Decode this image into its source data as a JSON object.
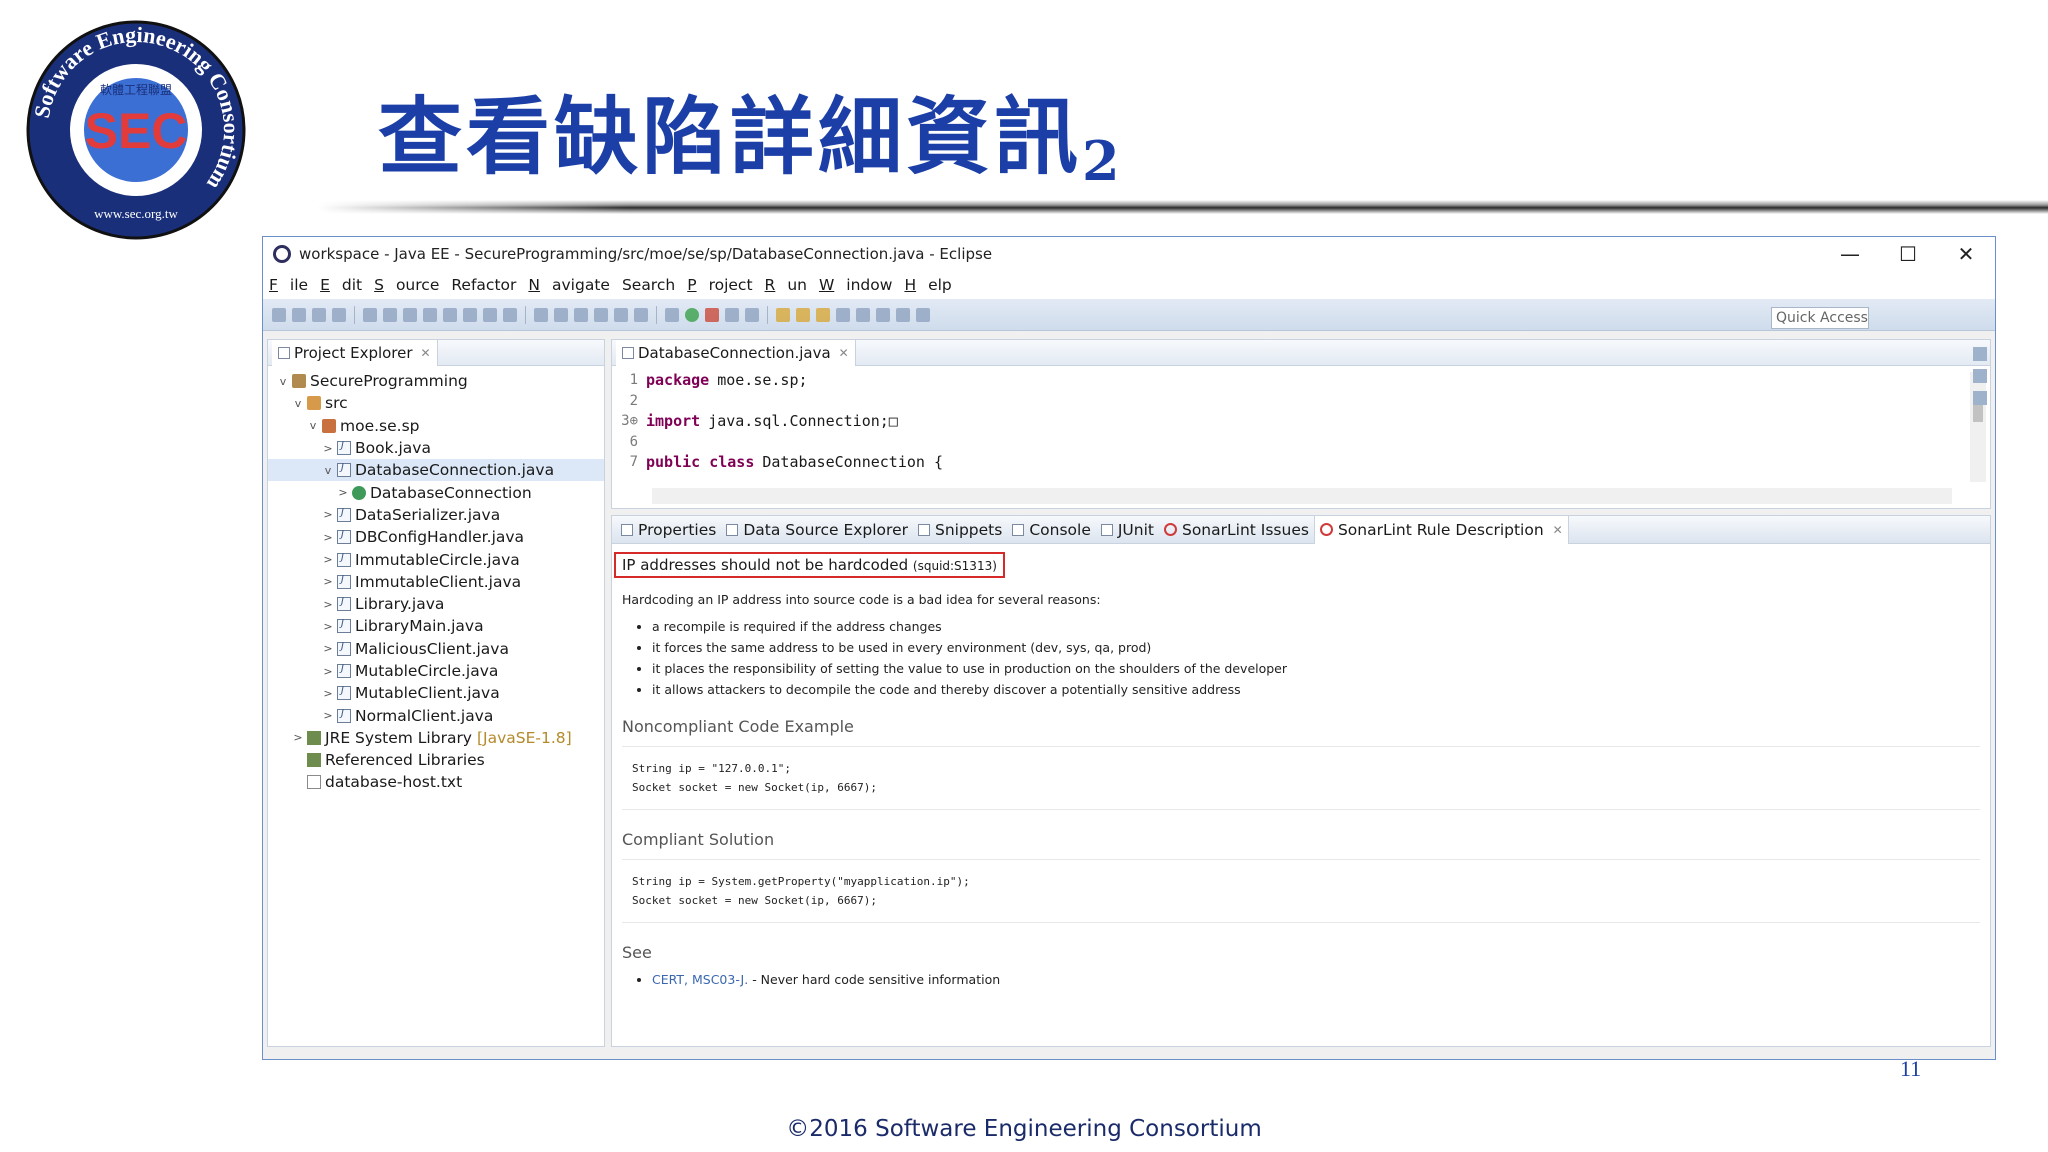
{
  "slide": {
    "title": "查看缺陷詳細資訊",
    "title_subscript": "2",
    "page_number": "11",
    "copyright": "©2016 Software Engineering Consortium",
    "logo": {
      "ring_text": "Software Engineering Consortium",
      "center": "SEC",
      "chinese": "軟體工程聯盟",
      "url": "www.sec.org.tw"
    }
  },
  "window": {
    "title": "workspace - Java EE - SecureProgramming/src/moe/se/sp/DatabaseConnection.java - Eclipse",
    "controls": {
      "minimize": "—",
      "maximize": "☐",
      "close": "✕"
    }
  },
  "menu": [
    {
      "key": "F",
      "rest": "ile"
    },
    {
      "key": "E",
      "rest": "dit"
    },
    {
      "key": "S",
      "rest": "ource"
    },
    {
      "key": "",
      "rest": "Refactor"
    },
    {
      "key": "N",
      "rest": "avigate"
    },
    {
      "key": "",
      "rest": "Search"
    },
    {
      "key": "P",
      "rest": "roject"
    },
    {
      "key": "R",
      "rest": "un"
    },
    {
      "key": "W",
      "rest": "indow"
    },
    {
      "key": "H",
      "rest": "elp"
    }
  ],
  "toolbar": {
    "quick_access_placeholder": "Quick Access"
  },
  "project_explorer": {
    "tab_label": "Project Explorer",
    "tree": [
      {
        "label": "SecureProgramming",
        "level": 0,
        "twisty": "v",
        "icon": "proj"
      },
      {
        "label": "src",
        "level": 1,
        "twisty": "v",
        "icon": "src"
      },
      {
        "label": "moe.se.sp",
        "level": 2,
        "twisty": "v",
        "icon": "pkg"
      },
      {
        "label": "Book.java",
        "level": 3,
        "twisty": ">",
        "icon": "java"
      },
      {
        "label": "DatabaseConnection.java",
        "level": 3,
        "twisty": "v",
        "icon": "java",
        "selected": true
      },
      {
        "label": "DatabaseConnection",
        "level": 4,
        "twisty": ">",
        "icon": "cls"
      },
      {
        "label": "DataSerializer.java",
        "level": 3,
        "twisty": ">",
        "icon": "java"
      },
      {
        "label": "DBConfigHandler.java",
        "level": 3,
        "twisty": ">",
        "icon": "java"
      },
      {
        "label": "ImmutableCircle.java",
        "level": 3,
        "twisty": ">",
        "icon": "java"
      },
      {
        "label": "ImmutableClient.java",
        "level": 3,
        "twisty": ">",
        "icon": "java"
      },
      {
        "label": "Library.java",
        "level": 3,
        "twisty": ">",
        "icon": "java"
      },
      {
        "label": "LibraryMain.java",
        "level": 3,
        "twisty": ">",
        "icon": "java"
      },
      {
        "label": "MaliciousClient.java",
        "level": 3,
        "twisty": ">",
        "icon": "java"
      },
      {
        "label": "MutableCircle.java",
        "level": 3,
        "twisty": ">",
        "icon": "java"
      },
      {
        "label": "MutableClient.java",
        "level": 3,
        "twisty": ">",
        "icon": "java"
      },
      {
        "label": "NormalClient.java",
        "level": 3,
        "twisty": ">",
        "icon": "java"
      },
      {
        "label": "JRE System Library",
        "suffix": "[JavaSE-1.8]",
        "level": 1,
        "twisty": ">",
        "icon": "lib"
      },
      {
        "label": "Referenced Libraries",
        "level": 1,
        "twisty": "",
        "icon": "lib"
      },
      {
        "label": "database-host.txt",
        "level": 1,
        "twisty": "",
        "icon": "txt"
      }
    ]
  },
  "editor": {
    "tab_label": "DatabaseConnection.java",
    "lines": [
      {
        "num": "1",
        "kw": "package",
        "text": "moe.se.sp;"
      },
      {
        "num": "2",
        "kw": "",
        "text": ""
      },
      {
        "num": "3⊕",
        "kw": "import",
        "text": "java.sql.Connection;□"
      },
      {
        "num": "6",
        "kw": "",
        "text": ""
      },
      {
        "num": "7",
        "kw": "public class",
        "text": "DatabaseConnection {"
      }
    ]
  },
  "bottom_panel": {
    "tabs": [
      "Properties",
      "Data Source Explorer",
      "Snippets",
      "Console",
      "JUnit",
      "SonarLint Issues",
      "SonarLint Rule Description"
    ],
    "rule_title": "IP addresses should not be hardcoded",
    "rule_key": "(squid:S1313)",
    "intro": "Hardcoding an IP address into source code is a bad idea for several reasons:",
    "reasons": [
      "a recompile is required if the address changes",
      "it forces the same address to be used in every environment (dev, sys, qa, prod)",
      "it places the responsibility of setting the value to use in production on the shoulders of the developer",
      "it allows attackers to decompile the code and thereby discover a potentially sensitive address"
    ],
    "noncompliant_heading": "Noncompliant Code Example",
    "noncompliant_code": [
      "String ip = \"127.0.0.1\";",
      "Socket socket = new Socket(ip, 6667);"
    ],
    "compliant_heading": "Compliant Solution",
    "compliant_code": [
      "String ip = System.getProperty(\"myapplication.ip\");",
      "Socket socket = new Socket(ip, 6667);"
    ],
    "see_heading": "See",
    "see_link": "CERT, MSC03-J.",
    "see_text": " - Never hard code sensitive information"
  }
}
